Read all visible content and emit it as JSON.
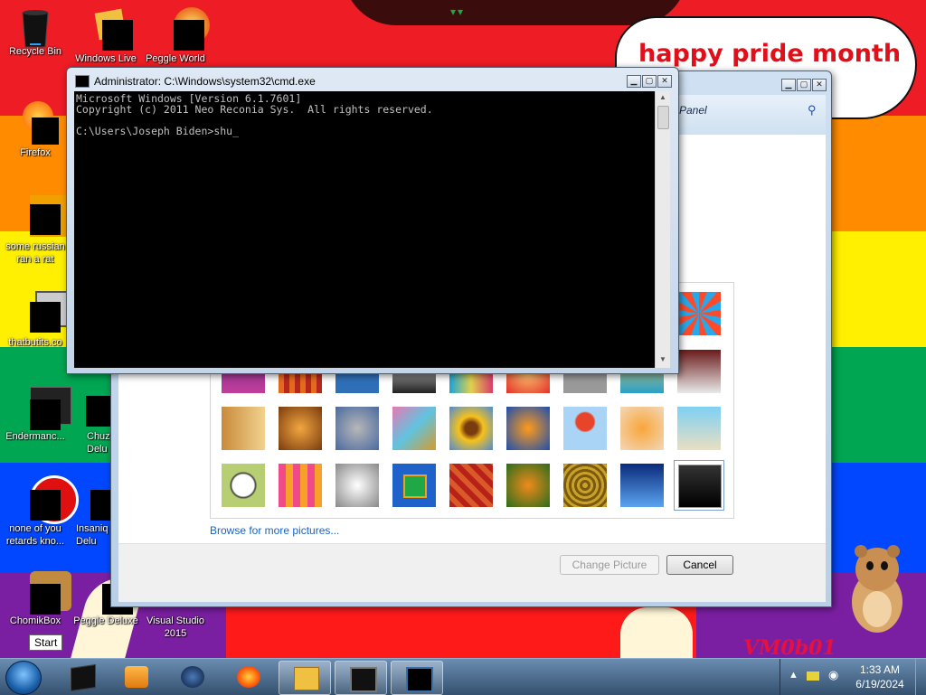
{
  "wallpaper": {
    "banner_text": "happy pride month",
    "signature": "VM0b01"
  },
  "desktop_icons": [
    {
      "label": "Recycle Bin"
    },
    {
      "label": "Windows Live"
    },
    {
      "label": "Peggle World"
    },
    {
      "label": "Firefox"
    },
    {
      "label": "some russian ran a rat"
    },
    {
      "label": "thatbutits.co"
    },
    {
      "label": "Endermanc..."
    },
    {
      "label": "Chuz Delu"
    },
    {
      "label": "none of you retards kno..."
    },
    {
      "label": "Insaniq Delu"
    },
    {
      "label": "ChomikBox"
    },
    {
      "label": "Peggle Deluxe"
    },
    {
      "label": "Visual Studio 2015"
    }
  ],
  "control_panel": {
    "breadcrumb": "Panel",
    "browse_link": "Browse for more pictures...",
    "change_picture": "Change Picture",
    "cancel": "Cancel"
  },
  "cmd": {
    "title": "Administrator: C:\\Windows\\system32\\cmd.exe",
    "lines": [
      "Microsoft Windows [Version 6.1.7601]",
      "Copyright (c) 2011 Neo Reconia Sys.  All rights reserved.",
      "",
      "C:\\Users\\Joseph Biden>shu_"
    ]
  },
  "taskbar": {
    "start_tooltip": "Start",
    "time": "1:33 AM",
    "date": "6/19/2024"
  },
  "colors": {
    "pride": [
      "#ee1c25",
      "#ff8c00",
      "#ffef00",
      "#00a651",
      "#0047ff",
      "#7b1fa2"
    ],
    "link": "#1563c7",
    "banner_text": "#e0101a"
  }
}
